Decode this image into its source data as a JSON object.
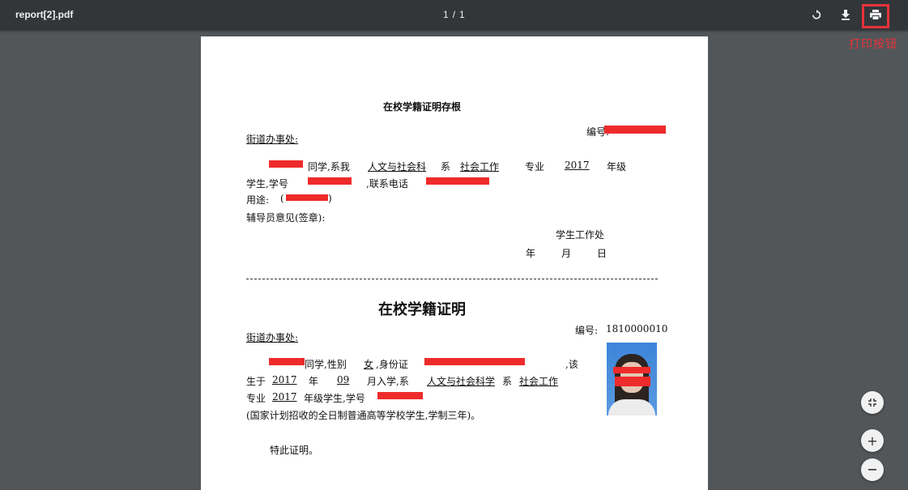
{
  "toolbar": {
    "file_name": "report[2].pdf",
    "page_current": "1",
    "page_separator": "/",
    "page_total": "1",
    "icons": {
      "rotate": "rotate-icon",
      "download": "download-icon",
      "print": "print-icon"
    }
  },
  "annotation": {
    "text": "打印按钮",
    "color": "#e8323a"
  },
  "document": {
    "stub": {
      "title": "在校学籍证明存根",
      "addressee": "街道办事处:",
      "serial_label": "编号:",
      "line1": {
        "student_suffix": "同学,系我",
        "department": "人文与社会科",
        "dept_suffix": "系",
        "major": "社会工作",
        "major_suffix": "专业",
        "grade": "2017",
        "grade_suffix": "年级"
      },
      "line2": {
        "prefix": "学生,学号",
        "phone_label": ",联系电话"
      },
      "line3": {
        "purpose_label": "用途:",
        "paren_open": "(",
        "paren_close": ")"
      },
      "line4": {
        "counselor": "辅导员意见(签章):"
      },
      "signoff": {
        "office": "学生工作处",
        "year": "年",
        "month": "月",
        "day": "日"
      }
    },
    "certificate": {
      "title": "在校学籍证明",
      "addressee": "街道办事处:",
      "serial_label": "编号:",
      "serial_value": "1810000010",
      "line1": {
        "student_suffix": "同学,性别",
        "gender": "女",
        "id_label": ",身份证",
        "tail": ",该"
      },
      "line2": {
        "born_prefix": "生于",
        "born_year": "2017",
        "year_char": "年",
        "born_month": "09",
        "enroll_suffix": "月入学,系",
        "department": "人文与社会科学",
        "dept_suffix": "系",
        "major": "社会工作"
      },
      "line3": {
        "prefix": "专业",
        "grade": "2017",
        "grade_suffix": "年级学生,学号"
      },
      "line4": {
        "note": "(国家计划招收的全日制普通高等学校学生,学制三年)。"
      },
      "closing": "特此证明。"
    }
  },
  "side_controls": {
    "fit_icon": "fit-page-icon",
    "zoom_in_icon": "zoom-in-icon",
    "zoom_out_icon": "zoom-out-icon",
    "zoom_in_label": "+"
  },
  "colors": {
    "toolbar_bg": "#323639",
    "viewer_bg": "#525659",
    "redaction": "#ee2b2b"
  }
}
